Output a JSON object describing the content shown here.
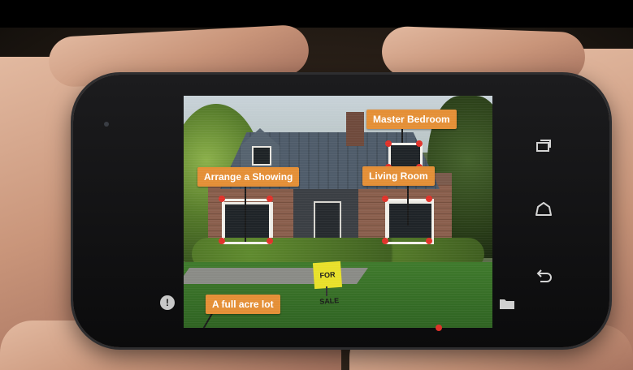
{
  "tags": {
    "master_bedroom": "Master Bedroom",
    "arrange_showing": "Arrange a Showing",
    "living_room": "Living Room",
    "full_acre_lot": "A full acre lot"
  },
  "sign": {
    "text": "FOR SALE"
  },
  "help_button": {
    "glyph": "!"
  },
  "nav_icons": [
    "recent-apps-icon",
    "home-icon",
    "back-icon"
  ],
  "colors": {
    "tag_bg": "#e48f36",
    "marker_dot": "#e0322a",
    "marker_frame": "#f2f0ea"
  }
}
